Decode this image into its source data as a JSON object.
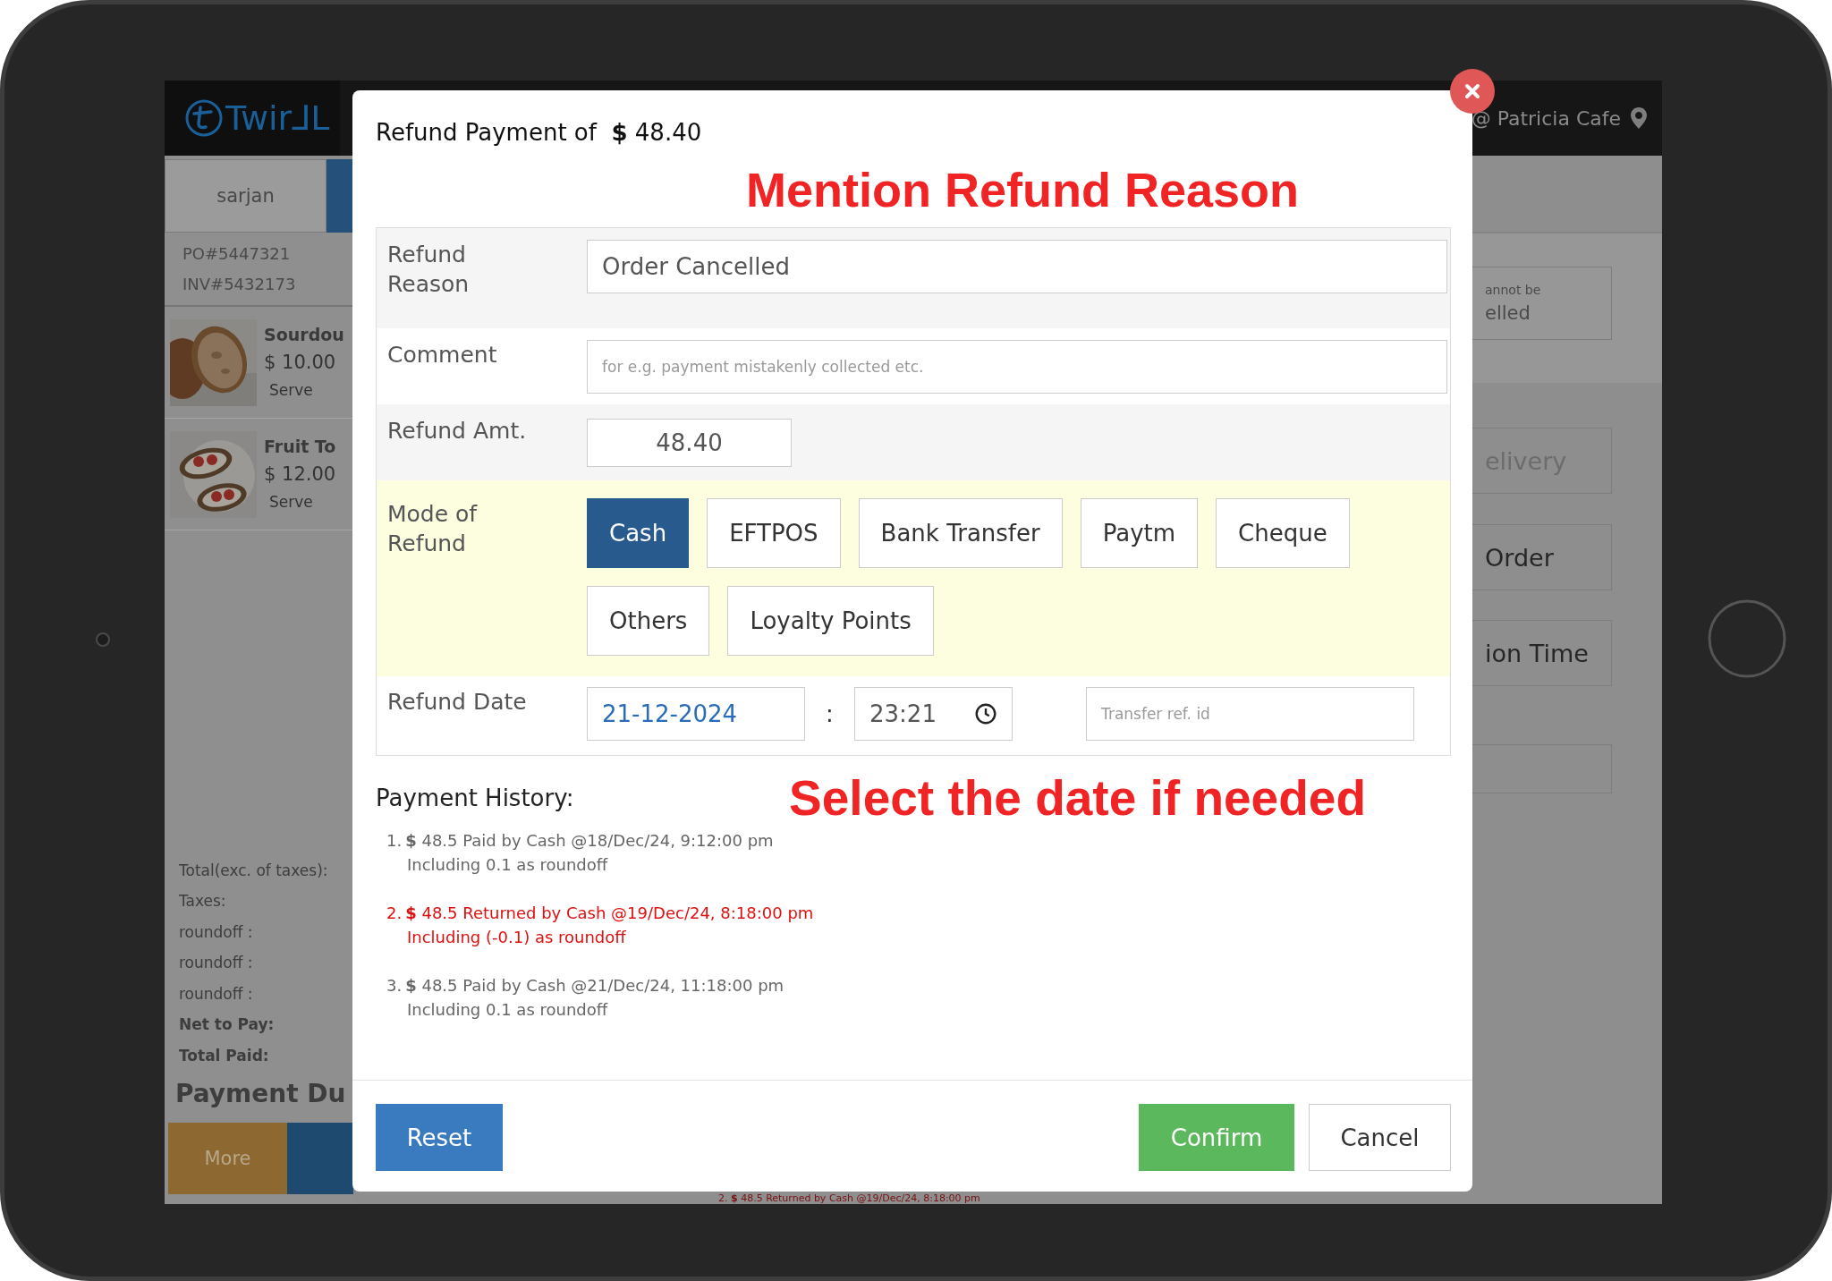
{
  "header": {
    "logo_text": "Twir⅃L",
    "location": "@ Patricia Cafe"
  },
  "order_panel": {
    "customer_tab": "sarjan",
    "po_number": "PO#5447321",
    "invoice_number": "INV#5432173",
    "items": [
      {
        "name": "Sourdou",
        "price": "$ 10.00",
        "status": "Serve",
        "kind": "bread"
      },
      {
        "name": "Fruit To",
        "price": "$ 12.00",
        "status": "Serve",
        "kind": "toast"
      }
    ],
    "totals": [
      {
        "label": "Total(exc. of taxes):",
        "bold": false
      },
      {
        "label": "Taxes:",
        "bold": false
      },
      {
        "label": "roundoff :",
        "bold": false
      },
      {
        "label": "roundoff :",
        "bold": false
      },
      {
        "label": "roundoff :",
        "bold": false
      },
      {
        "label": "Net to Pay:",
        "bold": true
      },
      {
        "label": "Total Paid:",
        "bold": true
      }
    ],
    "payment_due": "Payment Du",
    "more_button": "More"
  },
  "action_panel": {
    "notice": {
      "line_1": "annot be",
      "line_2": "elled"
    },
    "buttons": [
      {
        "label": "elivery",
        "disabled": true
      },
      {
        "label": "Order",
        "disabled": false
      },
      {
        "label": "ion Time",
        "disabled": false
      }
    ]
  },
  "history_behind": "2. **$** 48.5 Returned by Cash @19/Dec/24, 8:18:00 pm",
  "dialog": {
    "title": "Refund Payment of  **$** 48.40",
    "annotations": [
      "Mention Refund Reason",
      "Select the date if needed"
    ],
    "form": {
      "reason": {
        "label": "Refund Reason",
        "value": "Order Cancelled"
      },
      "comment": {
        "label": "Comment",
        "placeholder": "for e.g. payment mistakenly collected etc."
      },
      "amount": {
        "label": "Refund Amt.",
        "value": "48.40"
      },
      "mode": {
        "label": "Mode of Refund",
        "options": [
          {
            "label": "Cash",
            "selected": true
          },
          {
            "label": "EFTPOS",
            "selected": false
          },
          {
            "label": "Bank Transfer",
            "selected": false
          },
          {
            "label": "Paytm",
            "selected": false
          },
          {
            "label": "Cheque",
            "selected": false
          },
          {
            "label": "Others",
            "selected": false
          },
          {
            "label": "Loyalty Points",
            "selected": false
          }
        ]
      },
      "date": {
        "label": "Refund Date",
        "date": "21-12-2024",
        "separator": ":",
        "time": "23:21",
        "reference_placeholder": "Transfer ref. id"
      }
    },
    "history_heading": "Payment History:",
    "history": [
      {
        "marker": "1.",
        "line": "**$** 48.5 Paid by Cash @18/Dec/24, 9:12:00 pm",
        "note": "Including 0.1 as roundoff",
        "kind": "paid"
      },
      {
        "marker": "2.",
        "line": "**$** 48.5 Returned by Cash @19/Dec/24, 8:18:00 pm",
        "note": "Including (-0.1) as roundoff",
        "kind": "returned"
      },
      {
        "marker": "3.",
        "line": "**$** 48.5 Paid by Cash @21/Dec/24, 11:18:00 pm",
        "note": "Including 0.1 as roundoff",
        "kind": "paid"
      }
    ],
    "buttons": {
      "reset": "Reset",
      "confirm": "Confirm",
      "cancel": "Cancel"
    }
  }
}
